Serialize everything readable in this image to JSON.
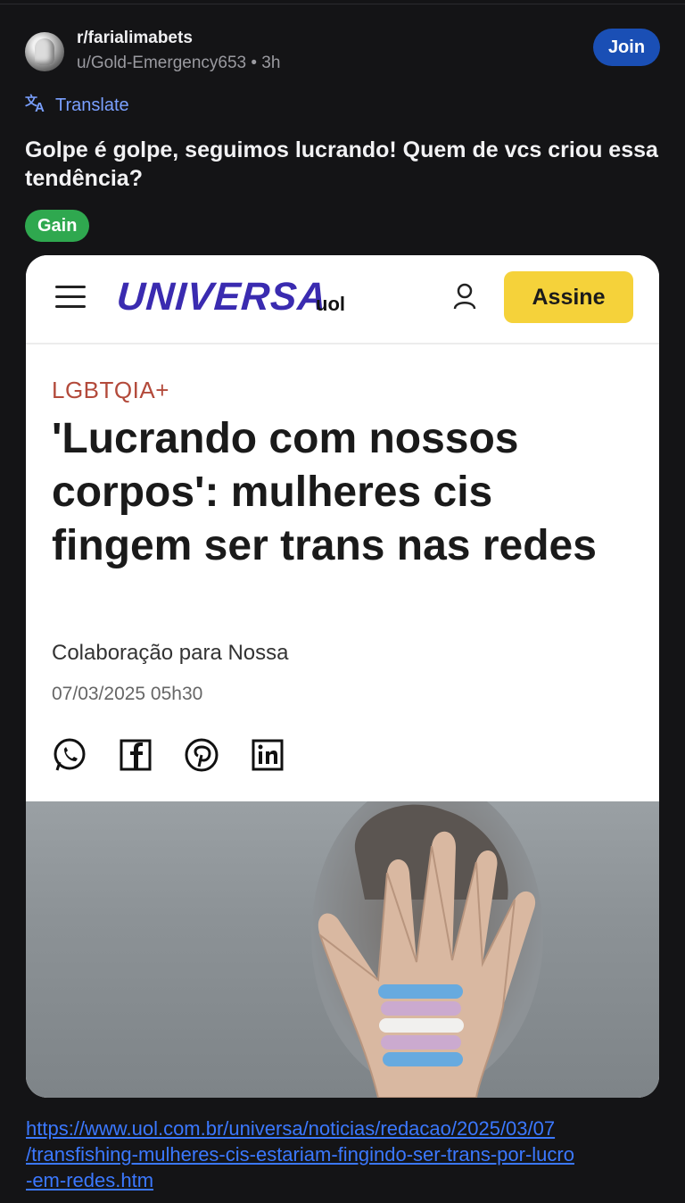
{
  "post": {
    "subreddit": "r/farialimabets",
    "author_time": "u/Gold-Emergency653 • 3h",
    "join_label": "Join",
    "translate_label": "Translate",
    "title": "Golpe é golpe, seguimos lucrando! Quem de vcs criou essa tendência?",
    "flair": "Gain",
    "link_lines": [
      "https://www.uol.com.br/universa/noticias/redacao/2025/03/07",
      "/transfishing-mulheres-cis-estariam-fingindo-ser-trans-por-lucro",
      "-em-redes.htm"
    ]
  },
  "article": {
    "brand": "UNIVERSA",
    "brand_sub": "uol",
    "subscribe_label": "Assine",
    "category": "LGBTQIA+",
    "headline": "'Lucrando com nossos corpos': mulheres cis fingem ser trans nas redes",
    "byline": "Colaboração para Nossa",
    "date": "07/03/2025 05h30",
    "share_icons": [
      "whatsapp-icon",
      "facebook-icon",
      "pinterest-icon",
      "linkedin-icon"
    ]
  },
  "colors": {
    "background": "#141416",
    "join": "#1a4fb5",
    "flair": "#2fa84f",
    "brand": "#3a2bb0",
    "subscribe": "#f5d23a",
    "category": "#b34a3b",
    "link": "#3b78ff"
  }
}
